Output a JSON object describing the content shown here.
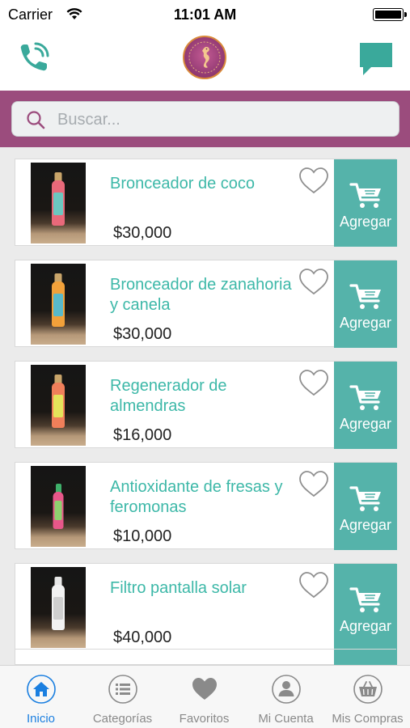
{
  "status_bar": {
    "carrier": "Carrier",
    "time": "11:01 AM"
  },
  "header": {
    "phone_icon": "phone-icon",
    "logo": "seahorse-logo",
    "chat_icon": "chat-bubble-icon"
  },
  "search": {
    "placeholder": "Buscar...",
    "value": ""
  },
  "products": [
    {
      "name": "Bronceador de coco",
      "price": "$30,000",
      "add_label": "Agregar",
      "bottle": {
        "cap": "#c9a56a",
        "body": "#e9697a",
        "label": "#6cc7c0",
        "short": false
      }
    },
    {
      "name": "Bronceador de zanahoria y canela",
      "price": "$30,000",
      "add_label": "Agregar",
      "bottle": {
        "cap": "#c9a56a",
        "body": "#f2a13a",
        "label": "#59b9c9",
        "short": false
      }
    },
    {
      "name": "Regenerador de almendras",
      "price": "$16,000",
      "add_label": "Agregar",
      "bottle": {
        "cap": "#c9a56a",
        "body": "#f07f5a",
        "label": "#e4e35a",
        "short": false
      }
    },
    {
      "name": "Antioxidante de fresas y feromonas",
      "price": "$10,000",
      "add_label": "Agregar",
      "bottle": {
        "cap": "#3fb06a",
        "body": "#e7578a",
        "label": "#8fd06f",
        "short": true
      }
    },
    {
      "name": "Filtro pantalla solar",
      "price": "$40,000",
      "add_label": "Agregar",
      "bottle": {
        "cap": "#e8e8e8",
        "body": "#f2f2f2",
        "label": "#cfcfcf",
        "short": false
      }
    }
  ],
  "tabs": [
    {
      "label": "Inicio",
      "icon": "home-icon",
      "active": true
    },
    {
      "label": "Categorías",
      "icon": "list-icon",
      "active": false
    },
    {
      "label": "Favoritos",
      "icon": "heart-icon",
      "active": false
    },
    {
      "label": "Mi Cuenta",
      "icon": "user-icon",
      "active": false
    },
    {
      "label": "Mis Compras",
      "icon": "basket-icon",
      "active": false
    }
  ],
  "colors": {
    "accent": "#55b3aa",
    "header_band": "#9b4c7d",
    "text_accent": "#3db8a8",
    "tab_active": "#1b7fe0"
  }
}
